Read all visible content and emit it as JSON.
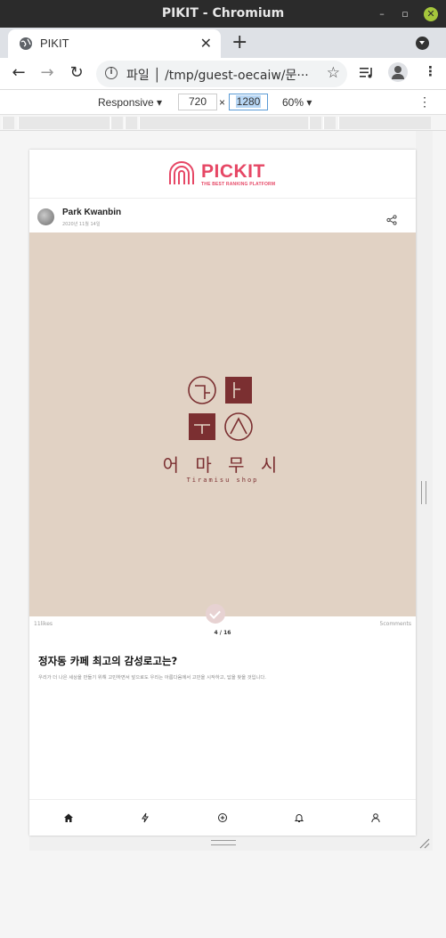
{
  "window": {
    "title": "PIKIT - Chromium"
  },
  "tab": {
    "title": "PIKIT",
    "close": "✕",
    "new": "+"
  },
  "toolbar": {
    "url": "파일  │  /tmp/guest-oecaiw/문···"
  },
  "device": {
    "mode": "Responsive ▾",
    "width": "720",
    "times": "×",
    "height": "1280",
    "zoom": "60% ▾"
  },
  "app": {
    "brand": "PICKIT",
    "tagline": "THE BEST RANKING PLATFORM",
    "brand_color": "#e64765"
  },
  "post": {
    "author": "Park Kwanbin",
    "date": "2020년 11월 14일",
    "likes": "11likes",
    "comments": "5comments",
    "pager": "4 / 16",
    "title": "정자동 카페 최고의 감성로고는?",
    "description": "우리가 더 나은 세상을 만들기 위해 고민하면서 앞으로도 우리는 아름다움에서 고민을 시작하고, 답을 찾을 것입니다."
  },
  "hero": {
    "bg": "#e1d2c4",
    "logo_color": "#7b2f31",
    "korean_name": "어 마 무 시",
    "english_name": "Tiramisu shop"
  },
  "bottom_nav": [
    "home-icon",
    "bolt-icon",
    "plus-circle-icon",
    "bell-icon",
    "user-icon"
  ]
}
